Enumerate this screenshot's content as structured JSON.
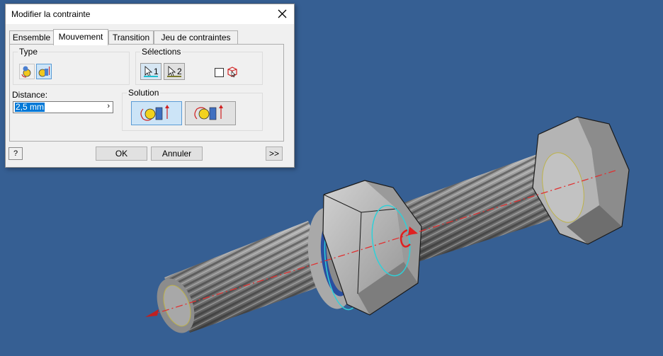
{
  "dialog": {
    "title": "Modifier la contrainte",
    "close_icon": "close-icon",
    "tabs": [
      {
        "label": "Ensemble"
      },
      {
        "label": "Mouvement"
      },
      {
        "label": "Transition"
      },
      {
        "label": "Jeu de contraintes"
      }
    ],
    "active_tab": "Mouvement",
    "type_group": {
      "label": "Type",
      "buttons": [
        {
          "icon": "rotation-type-icon",
          "selected": false
        },
        {
          "icon": "rotation-translation-type-icon",
          "selected": true
        }
      ]
    },
    "selections_group": {
      "label": "Sélections",
      "select1_number": "1",
      "select2_number": "2",
      "select1_color": "#1fbfd0",
      "select2_color": "#7a7a2a",
      "checkbox_checked": false,
      "pick_part_icon": "pick-part-first-icon"
    },
    "distance": {
      "label": "Distance:",
      "value": "2,5 mm",
      "arrow": "›"
    },
    "solution_group": {
      "label": "Solution",
      "buttons": [
        {
          "icon": "forward-solution-icon",
          "selected": true
        },
        {
          "icon": "reverse-solution-icon",
          "selected": false
        }
      ]
    },
    "footer": {
      "help_label": "?",
      "ok_label": "OK",
      "cancel_label": "Annuler",
      "more_label": ">>"
    }
  },
  "viewport": {
    "background_color": "#365f93",
    "model": "bolt-with-nuts-assembly"
  }
}
